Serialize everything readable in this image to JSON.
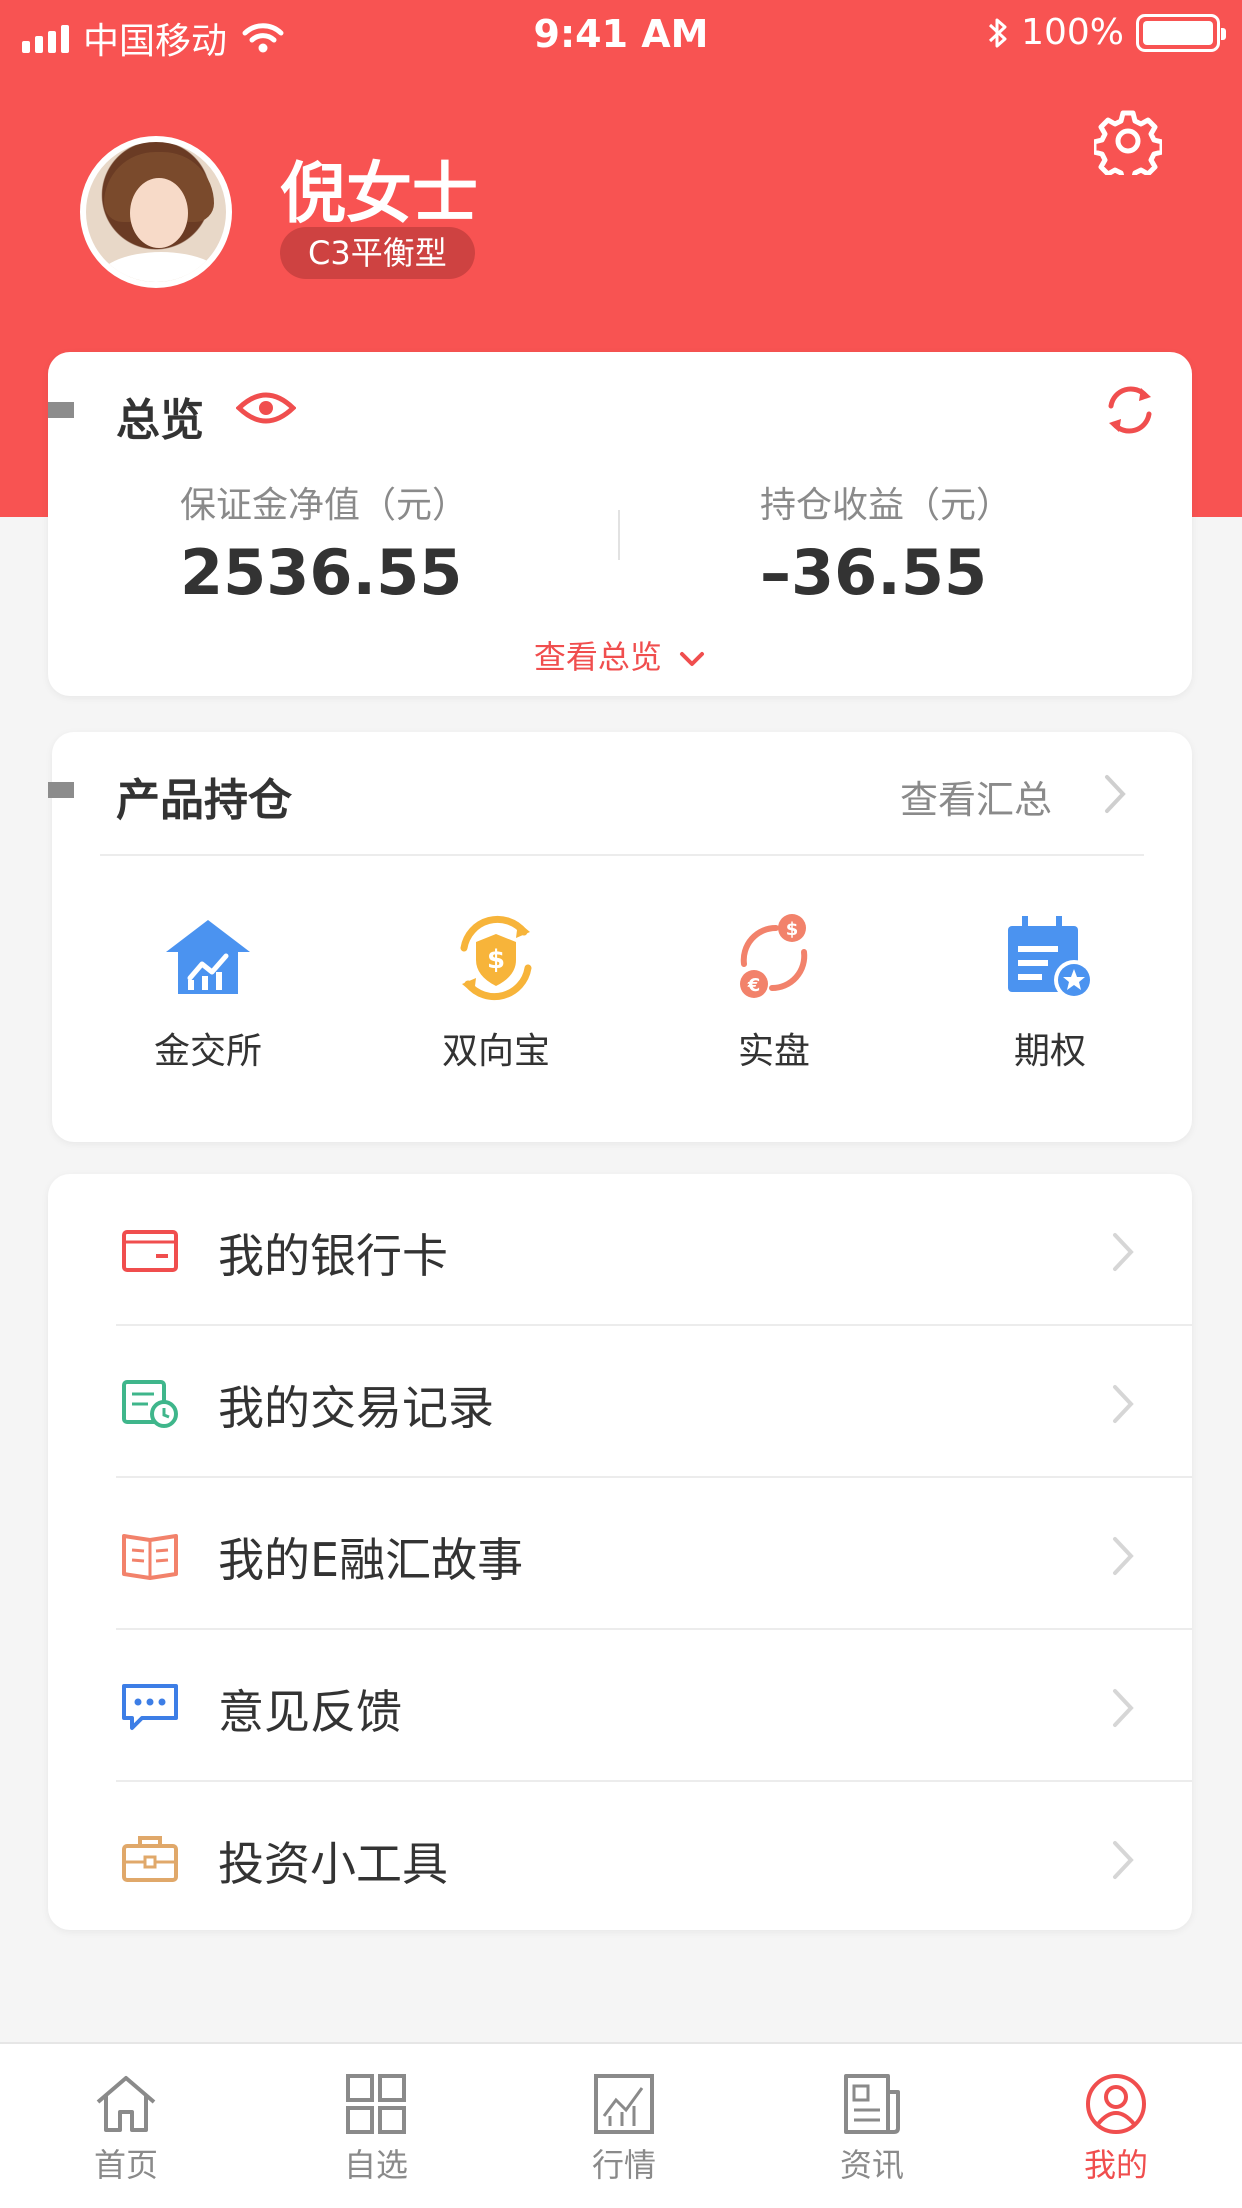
{
  "status_bar": {
    "carrier": "中国移动",
    "time": "9:41 AM",
    "battery": "100%"
  },
  "profile": {
    "name": "倪女士",
    "risk_level": "C3平衡型"
  },
  "overview": {
    "title": "总览",
    "margin_label": "保证金净值（元）",
    "margin_value": "2536.55",
    "pnl_label": "持仓收益（元）",
    "pnl_value": "–36.55",
    "view_link": "查看总览"
  },
  "holdings": {
    "title": "产品持仓",
    "summary_link": "查看汇总",
    "products": [
      {
        "label": "金交所",
        "icon": "exchange-building-icon"
      },
      {
        "label": "双向宝",
        "icon": "shield-coin-icon"
      },
      {
        "label": "实盘",
        "icon": "currency-exchange-icon"
      },
      {
        "label": "期权",
        "icon": "calendar-star-icon"
      }
    ]
  },
  "menu": {
    "items": [
      {
        "label": "我的银行卡",
        "icon": "bank-card-icon"
      },
      {
        "label": "我的交易记录",
        "icon": "calendar-clock-icon"
      },
      {
        "label": "我的E融汇故事",
        "icon": "book-icon"
      },
      {
        "label": "意见反馈",
        "icon": "chat-icon"
      },
      {
        "label": "投资小工具",
        "icon": "toolbox-icon"
      }
    ]
  },
  "tabbar": {
    "items": [
      {
        "label": "首页",
        "icon": "home-icon"
      },
      {
        "label": "自选",
        "icon": "grid-icon"
      },
      {
        "label": "行情",
        "icon": "chart-icon"
      },
      {
        "label": "资讯",
        "icon": "news-icon"
      },
      {
        "label": "我的",
        "icon": "user-icon",
        "active": true
      }
    ]
  },
  "colors": {
    "brand": "#f85352",
    "accent_red": "#f04e4e",
    "badge": "#ce4241"
  }
}
